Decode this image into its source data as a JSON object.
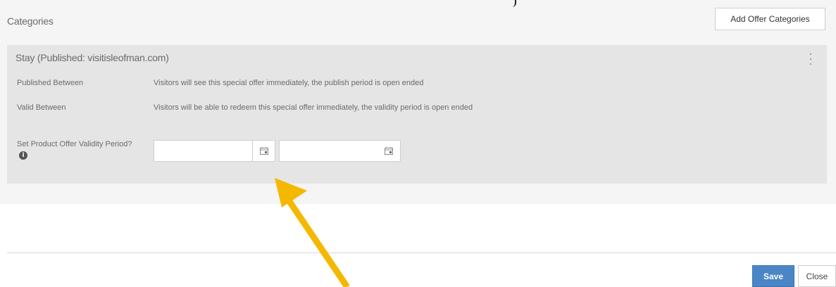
{
  "panel": {
    "title": "Categories",
    "add_button_label": "Add Offer Categories"
  },
  "category": {
    "title": "Stay (Published: visitisleofman.com)",
    "rows": [
      {
        "label": "Published Between",
        "value": "Visitors will see this special offer immediately, the publish period is open ended"
      },
      {
        "label": "Valid Between",
        "value": "Visitors will be able to redeem this special offer immediately, the validity period is open ended"
      }
    ],
    "validity": {
      "label": "Set Product Offer Validity Period?",
      "info_icon": "info-icon",
      "start_value": "",
      "end_value": ""
    }
  },
  "footer": {
    "save_label": "Save",
    "close_label": "Close"
  },
  "annotation": {
    "arrow_color": "#f5b800"
  },
  "colors": {
    "panel_bg": "#f5f5f5",
    "card_bg": "#e5e5e5",
    "primary": "#4a86c5"
  }
}
